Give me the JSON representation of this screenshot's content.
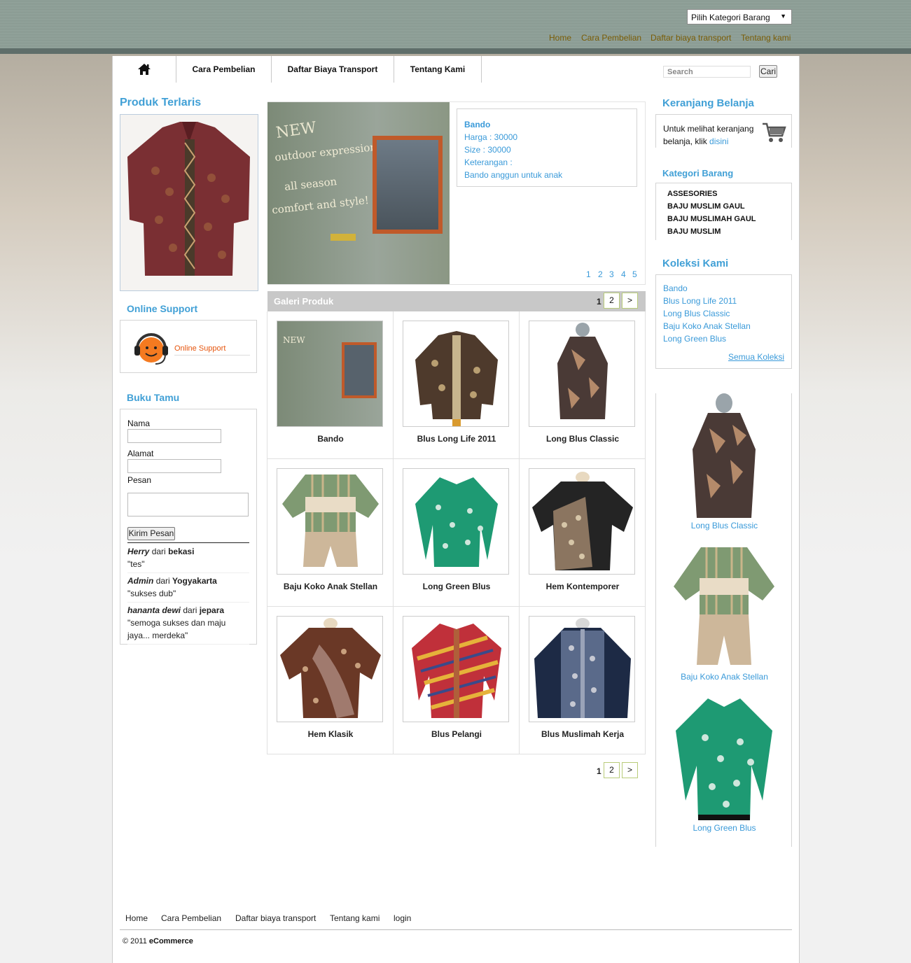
{
  "header": {
    "category_select": "Pilih Kategori Barang",
    "top_links": [
      "Home",
      "Cara Pembelian",
      "Daftar biaya transport",
      "Tentang kami"
    ]
  },
  "nav": {
    "items": [
      "Cara Pembelian",
      "Daftar Biaya Transport",
      "Tentang Kami"
    ],
    "search_placeholder": "Search",
    "search_button": "Cari"
  },
  "left": {
    "best_title": "Produk Terlaris",
    "support_title": "Online Support",
    "support_label": "Online Support",
    "guestbook_title": "Buku Tamu",
    "form": {
      "name_label": "Nama",
      "address_label": "Alamat",
      "message_label": "Pesan",
      "submit": "Kirim Pesan"
    },
    "entries": [
      {
        "name": "Herry",
        "from": "dari",
        "city": "bekasi",
        "message": "\"tes\""
      },
      {
        "name": "Admin",
        "from": "dari",
        "city": "Yogyakarta",
        "message": "\"sukses dub\""
      },
      {
        "name": "hananta dewi",
        "from": "dari",
        "city": "jepara",
        "message": "\"semoga sukses dan maju jaya... merdeka\""
      }
    ]
  },
  "slider": {
    "banner_text": [
      "NEW",
      "outdoor expressions",
      "all season",
      "comfort and style!"
    ],
    "title": "Bando",
    "price": "Harga : 30000",
    "size": "Size : 30000",
    "note_label": "Keterangan :",
    "note": "Bando anggun untuk anak",
    "pages": [
      "1",
      "2",
      "3",
      "4",
      "5"
    ]
  },
  "gallery": {
    "title": "Galeri Produk",
    "current_page": "1",
    "next_page": "2",
    "next": ">",
    "items": [
      {
        "name": "Bando"
      },
      {
        "name": "Blus Long Life 2011"
      },
      {
        "name": "Long Blus Classic"
      },
      {
        "name": "Baju Koko Anak Stellan"
      },
      {
        "name": "Long Green Blus"
      },
      {
        "name": "Hem Kontemporer"
      },
      {
        "name": "Hem Klasik"
      },
      {
        "name": "Blus Pelangi"
      },
      {
        "name": "Blus Muslimah Kerja"
      }
    ]
  },
  "right": {
    "cart_title": "Keranjang Belanja",
    "cart_text": "Untuk melihat keranjang belanja, klik",
    "cart_link": "disini",
    "category_title": "Kategori Barang",
    "categories": [
      "ASSESORIES",
      "BAJU MUSLIM GAUL",
      "BAJU MUSLIMAH GAUL",
      "BAJU MUSLIM"
    ],
    "collection_title": "Koleksi Kami",
    "collections": [
      "Bando",
      "Blus Long Life 2011",
      "Long Blus Classic",
      "Baju Koko Anak Stellan",
      "Long Green Blus"
    ],
    "all_collections": "Semua Koleksi",
    "featured": [
      "Long Blus Classic",
      "Baju Koko Anak Stellan",
      "Long Green Blus"
    ]
  },
  "footer": {
    "links": [
      "Home",
      "Cara Pembelian",
      "Daftar biaya transport",
      "Tentang kami",
      "login"
    ],
    "copyright_prefix": "© 2011",
    "copyright_brand": "eCommerce"
  },
  "colors": {
    "accent": "#41a0d6",
    "link": "#3a9ad9",
    "top_link": "#7a5c05",
    "header": "#8fa098"
  }
}
